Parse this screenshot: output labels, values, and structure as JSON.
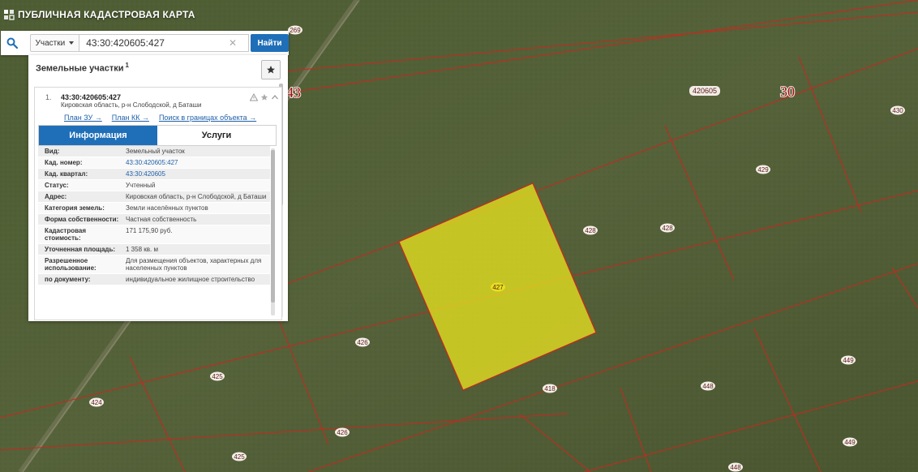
{
  "app": {
    "title": "ПУБЛИЧНАЯ КАДАСТРОВАЯ КАРТА"
  },
  "search": {
    "type_label": "Участки",
    "query": "43:30:420605:427",
    "button_label": "Найти"
  },
  "panel": {
    "title": "Земельные участки",
    "count": "1"
  },
  "result": {
    "index": "1.",
    "cad_number": "43:30:420605:427",
    "address": "Кировская область, р-н Слободской, д Баташи",
    "links": [
      "План ЗУ →",
      "План КК →",
      "Поиск в границах объекта →"
    ]
  },
  "tabs": [
    "Информация",
    "Услуги"
  ],
  "info_rows": [
    {
      "key": "Вид:",
      "value": "Земельный участок"
    },
    {
      "key": "Кад. номер:",
      "value": "43:30:420605:427"
    },
    {
      "key": "Кад. квартал:",
      "value": "43:30:420605"
    },
    {
      "key": "Статус:",
      "value": "Учтенный"
    },
    {
      "key": "Адрес:",
      "value": "Кировская область, р-н Слободской, д Баташи"
    },
    {
      "key": "Категория земель:",
      "value": "Земли населённых пунктов"
    },
    {
      "key": "Форма собственности:",
      "value": "Частная собственность"
    },
    {
      "key": "Кадастровая стоимость:",
      "value": "171 175,90 руб."
    },
    {
      "key": "Уточненная площадь:",
      "value": "1 358 кв. м"
    },
    {
      "key": "Разрешенное использование:",
      "value": "Для размещения объектов, характерных для населенных пунктов"
    },
    {
      "key": "по документу:",
      "value": "индивидуальное жилищное строительство"
    }
  ],
  "map_labels": {
    "big": [
      "43",
      "30"
    ],
    "quarter": "420605",
    "parcels": [
      "269",
      "430",
      "429",
      "428",
      "428",
      "427",
      "426",
      "425",
      "424",
      "426",
      "418",
      "425",
      "448",
      "449",
      "449",
      "448"
    ]
  },
  "colors": {
    "accent": "#1f6fb8",
    "parcel_fill": "#e6e020",
    "boundary": "#c8281e"
  }
}
